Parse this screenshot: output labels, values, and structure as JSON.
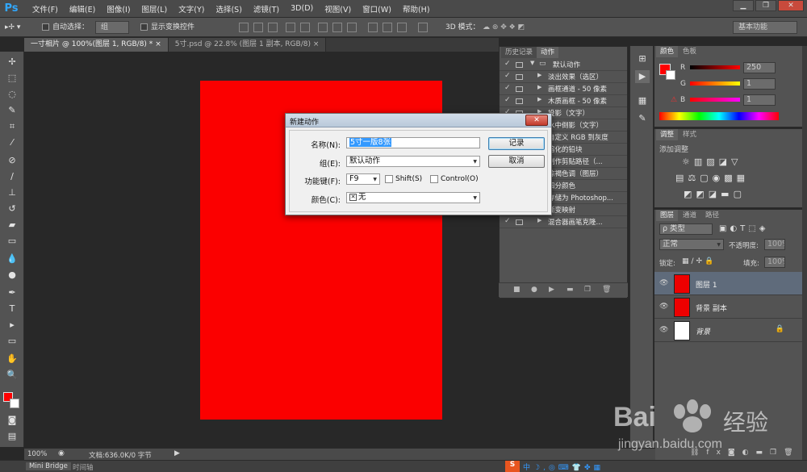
{
  "app": {
    "logo": "Ps"
  },
  "menu": [
    "文件(F)",
    "编辑(E)",
    "图像(I)",
    "图层(L)",
    "文字(Y)",
    "选择(S)",
    "滤镜(T)",
    "3D(D)",
    "视图(V)",
    "窗口(W)",
    "帮助(H)"
  ],
  "options": {
    "auto_select": "自动选择：",
    "auto_select_value": "组",
    "show_transform": "显示变换控件",
    "mode_3d": "3D 模式：",
    "workspace": "基本功能"
  },
  "tabs": [
    "一寸相片 @ 100%(图层 1, RGB/8) *",
    "5寸.psd @ 22.8% (图层 1 副本, RGB/8)"
  ],
  "midpanel": {
    "tabs": [
      "历史记录",
      "动作"
    ],
    "actions": [
      {
        "check": "✓",
        "open": true,
        "label": "默认动作"
      },
      {
        "check": "✓",
        "label": "淡出效果（选区）"
      },
      {
        "check": "✓",
        "label": "画框通道 - 50 像素"
      },
      {
        "check": "✓",
        "label": "木质画框 - 50 像素"
      },
      {
        "check": "✓",
        "label": "投影（文字）"
      },
      {
        "check": "✓",
        "label": "水中倒影（文字）"
      },
      {
        "check": "✓",
        "label": "自定义 RGB 到灰度"
      },
      {
        "check": "✓",
        "label": "熔化的铅块"
      },
      {
        "check": "✓",
        "label": "制作剪贴路径（..."
      },
      {
        "check": "✓",
        "label": "棕褐色调（图层）"
      },
      {
        "check": "✓",
        "label": "四分颜色"
      },
      {
        "check": "✓",
        "label": "存储为 Photoshop..."
      },
      {
        "check": "✓",
        "label": "渐变映射"
      },
      {
        "check": "✓",
        "label": "混合器画笔克隆..."
      }
    ]
  },
  "color_panel": {
    "tabs": [
      "颜色",
      "色板"
    ],
    "r": {
      "label": "R",
      "value": "250"
    },
    "g": {
      "label": "G",
      "value": "1"
    },
    "b": {
      "label": "B",
      "value": "1"
    }
  },
  "adj_panel": {
    "tabs": [
      "调整",
      "样式"
    ],
    "title": "添加调整"
  },
  "layers_panel": {
    "tabs": [
      "图层",
      "通道",
      "路径"
    ],
    "kind": "ρ 类型",
    "blend": "正常",
    "opacity_label": "不透明度:",
    "opacity": "100%",
    "lock_label": "锁定:",
    "fill_label": "填充:",
    "fill": "100%",
    "layers": [
      {
        "name": "图层 1",
        "color": "#ee0000",
        "selected": true
      },
      {
        "name": "背景 副本",
        "color": "#ee0000"
      },
      {
        "name": "背景",
        "color": "#ffffff",
        "locked": true
      }
    ]
  },
  "status": {
    "zoom": "100%",
    "doc": "文档:636.0K/0 字节"
  },
  "bottom_tabs": [
    "Mini Bridge",
    "时间轴"
  ],
  "dialog": {
    "title": "新建动作",
    "name_label": "名称(N):",
    "name_value": "5寸一版8张",
    "set_label": "组(E):",
    "set_value": "默认动作",
    "fkey_label": "功能键(F):",
    "fkey_value": "F9",
    "shift_label": "Shift(S)",
    "control_label": "Control(O)",
    "color_label": "颜色(C):",
    "color_value": "无",
    "record_btn": "记录",
    "cancel_btn": "取消"
  },
  "watermark": {
    "brand": "Bai",
    "brand2": "经验",
    "url": "jingyan.baidu.com"
  },
  "colors": {
    "foreground": "#ff0000",
    "canvas": "#fb0000",
    "accent": "#31a8ff"
  }
}
